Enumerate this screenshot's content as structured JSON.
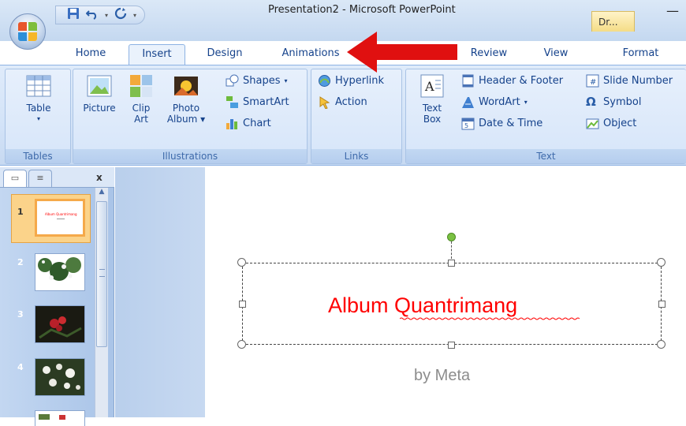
{
  "window": {
    "title": "Presentation2 - Microsoft PowerPoint",
    "context_tab": "Dr...",
    "minimize_glyph": "—"
  },
  "qat": {
    "save_icon": "save-icon",
    "undo_icon": "undo-icon",
    "redo_icon": "redo-icon",
    "customize_glyph": "▾"
  },
  "tabs": [
    {
      "label": "Home"
    },
    {
      "label": "Insert",
      "active": true
    },
    {
      "label": "Design"
    },
    {
      "label": "Animations"
    },
    {
      "label": "Review"
    },
    {
      "label": "View"
    },
    {
      "label": "Format"
    }
  ],
  "ribbon": {
    "tables": {
      "label": "Tables",
      "table": "Table"
    },
    "illustrations": {
      "label": "Illustrations",
      "picture": "Picture",
      "clip_line1": "Clip",
      "clip_line2": "Art",
      "photo_line1": "Photo",
      "photo_line2": "Album",
      "shapes": "Shapes",
      "smartart": "SmartArt",
      "chart": "Chart"
    },
    "links": {
      "label": "Links",
      "hyperlink": "Hyperlink",
      "action": "Action"
    },
    "text": {
      "label": "Text",
      "textbox_line1": "Text",
      "textbox_line2": "Box",
      "header_footer": "Header & Footer",
      "wordart": "WordArt",
      "date_time": "Date & Time",
      "slide_number": "Slide Number",
      "symbol": "Symbol",
      "object": "Object"
    }
  },
  "left_pane": {
    "close": "x",
    "slides": [
      {
        "num": "1",
        "title": "Album Quantrimang"
      },
      {
        "num": "2"
      },
      {
        "num": "3"
      },
      {
        "num": "4"
      }
    ]
  },
  "slide": {
    "title": "Album Quantrimang",
    "subtitle": "by Meta"
  },
  "colors": {
    "accent": "#15428b",
    "arrow": "#e01010",
    "title_text": "#ff0000",
    "selected_thumb": "#f5a94a"
  }
}
